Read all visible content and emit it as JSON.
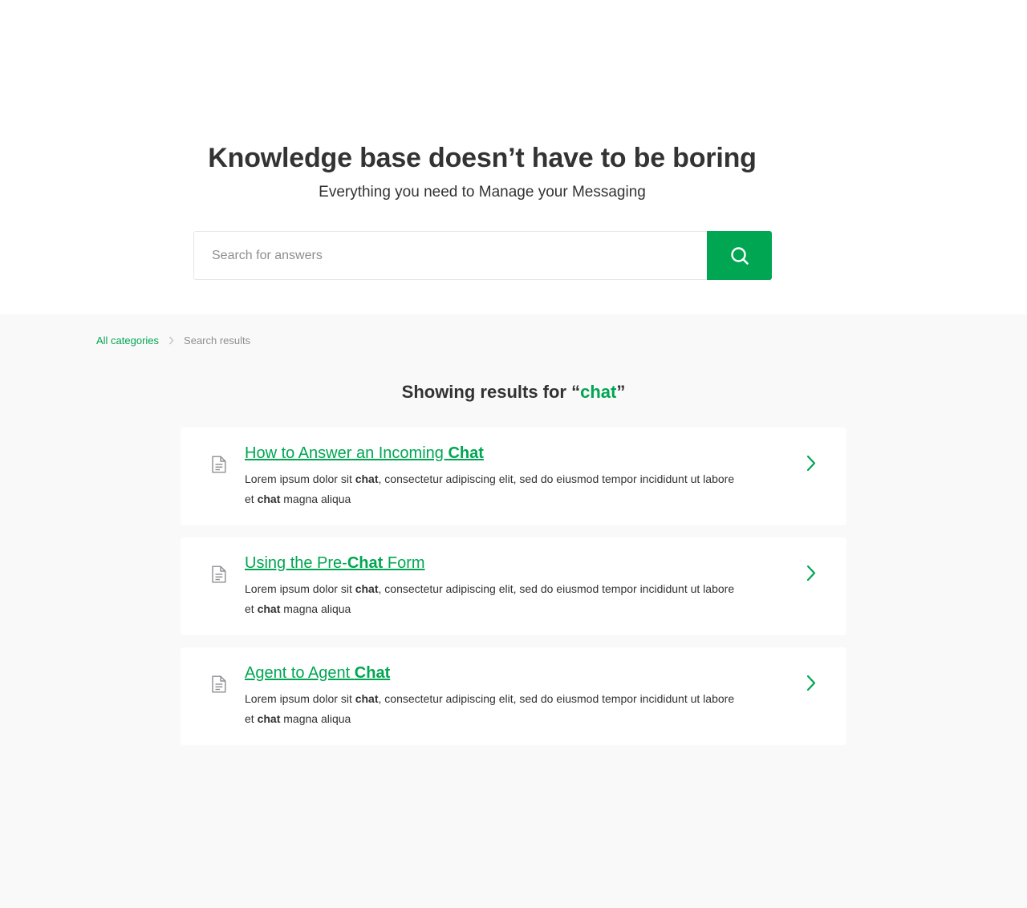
{
  "hero": {
    "title": "Knowledge base doesn’t have to be boring",
    "subtitle": "Everything you need to Manage your Messaging"
  },
  "search": {
    "placeholder": "Search for answers",
    "value": "",
    "button_icon": "search-icon"
  },
  "breadcrumb": {
    "root": "All categories",
    "separator_icon": "chevron-right-icon",
    "current": "Search results"
  },
  "results_heading": {
    "prefix": "Showing results for “",
    "term": "chat",
    "suffix": "”"
  },
  "results": [
    {
      "title_before": "How to Answer an Incoming ",
      "title_highlight": "Chat",
      "title_after": "",
      "snippet_1": "Lorem ipsum dolor sit ",
      "snippet_2": "chat",
      "snippet_3": ", consectetur adipiscing elit, sed do eiusmod tempor incididunt ut labore et ",
      "snippet_4": "chat",
      "snippet_5": " magna aliqua",
      "icon": "document-icon",
      "action_icon": "chevron-right-icon"
    },
    {
      "title_before": "Using the Pre-",
      "title_highlight": "Chat",
      "title_after": " Form",
      "snippet_1": "Lorem ipsum dolor sit ",
      "snippet_2": "chat",
      "snippet_3": ", consectetur adipiscing elit, sed do eiusmod tempor incididunt ut labore et ",
      "snippet_4": "chat",
      "snippet_5": " magna aliqua",
      "icon": "document-icon",
      "action_icon": "chevron-right-icon"
    },
    {
      "title_before": "Agent to Agent ",
      "title_highlight": "Chat",
      "title_after": "",
      "snippet_1": "Lorem ipsum dolor sit ",
      "snippet_2": "chat",
      "snippet_3": ", consectetur adipiscing elit, sed do eiusmod tempor incididunt ut labore et ",
      "snippet_4": "chat",
      "snippet_5": " magna aliqua",
      "icon": "document-icon",
      "action_icon": "chevron-right-icon"
    }
  ],
  "colors": {
    "accent": "#00a652",
    "text": "#333333",
    "muted": "#8e8e93",
    "page_background": "#f9f9f9",
    "card_background": "#ffffff"
  }
}
